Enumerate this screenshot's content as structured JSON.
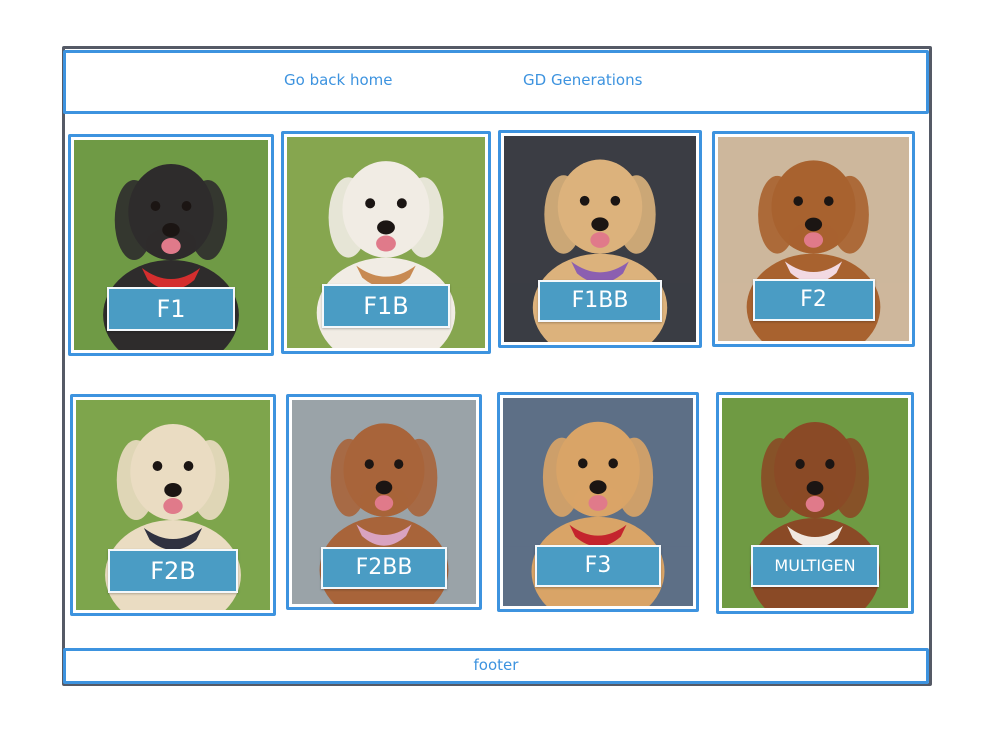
{
  "header": {
    "home_link": "Go back home",
    "generations_link": "GD Generations"
  },
  "cards": [
    {
      "label": "F1",
      "coat": "#2e2c2c",
      "bg": "#6f9a45",
      "accent": "#d42e2e"
    },
    {
      "label": "F1B",
      "coat": "#f1ece4",
      "bg": "#86a64f",
      "accent": "#c88a52"
    },
    {
      "label": "F1BB",
      "coat": "#dcb27c",
      "bg": "#3b3d44",
      "accent": "#8c5fb0"
    },
    {
      "label": "F2",
      "coat": "#a8622f",
      "bg": "#cdb79c",
      "accent": "#f2d9e2"
    },
    {
      "label": "F2B",
      "coat": "#eadcc2",
      "bg": "#7ea54c",
      "accent": "#2f3140"
    },
    {
      "label": "F2BB",
      "coat": "#a8643a",
      "bg": "#9aa3a8",
      "accent": "#d9a3c0"
    },
    {
      "label": "F3",
      "coat": "#d9a467",
      "bg": "#5d6f86",
      "accent": "#c4242d"
    },
    {
      "label": "MULTIGEN",
      "coat": "#8a4a26",
      "bg": "#6f9a43",
      "accent": "#f0e8e0"
    }
  ],
  "footer": {
    "text": "footer"
  },
  "colors": {
    "wireframe_blue": "#3d93df",
    "label_bg": "#4a9cc4",
    "frame_gray": "#555a66"
  }
}
